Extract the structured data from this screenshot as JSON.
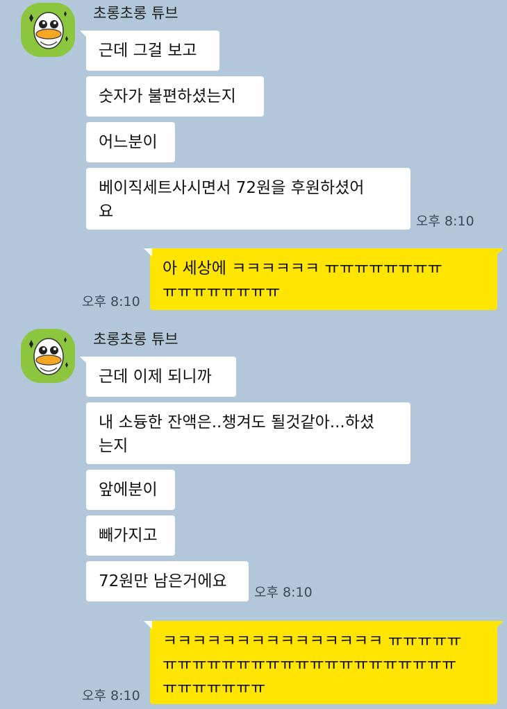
{
  "theme": {
    "chat_background": "#b2c7da",
    "incoming_bubble": "#ffffff",
    "outgoing_bubble": "#ffe500",
    "avatar_background": "#8cc63f"
  },
  "groups": [
    {
      "sender": "초롱초롱 튜브",
      "avatar_icon": "tube-duck-icon",
      "messages": [
        "근데 그걸 보고",
        "숫자가 불편하셨는지",
        "어느분이",
        "베이직세트사시면서 72원을 후원하셨어\n요"
      ],
      "time": "오후 8:10"
    },
    {
      "mine": true,
      "messages": [
        "아 세상에 ㅋㅋㅋㅋㅋㅋ ㅠㅠㅠㅠㅠㅠㅠㅠ\nㅠㅠㅠㅠㅠㅠㅠㅠ"
      ],
      "time": "오후 8:10"
    },
    {
      "sender": "초롱초롱 튜브",
      "avatar_icon": "tube-duck-icon",
      "messages": [
        "근데 이제 되니까",
        "내 소듕한 잔액은..챙겨도 될것같아...하셨\n는지",
        "앞에분이",
        "빼가지고",
        "72원만 남은거에요"
      ],
      "time": "오후 8:10"
    },
    {
      "mine": true,
      "messages": [
        "ㅋㅋㅋㅋㅋㅋㅋㅋㅋㅋㅋㅋㅋㅋㅋ ㅠㅠㅠㅠㅠ\nㅠㅠㅠㅠㅠㅠㅠㅠㅠㅠㅠㅠㅠㅠㅠㅠㅠㅠㅠㅠ\nㅠㅠㅠㅠㅠㅠㅠ"
      ],
      "time": "오후 8:10"
    }
  ]
}
